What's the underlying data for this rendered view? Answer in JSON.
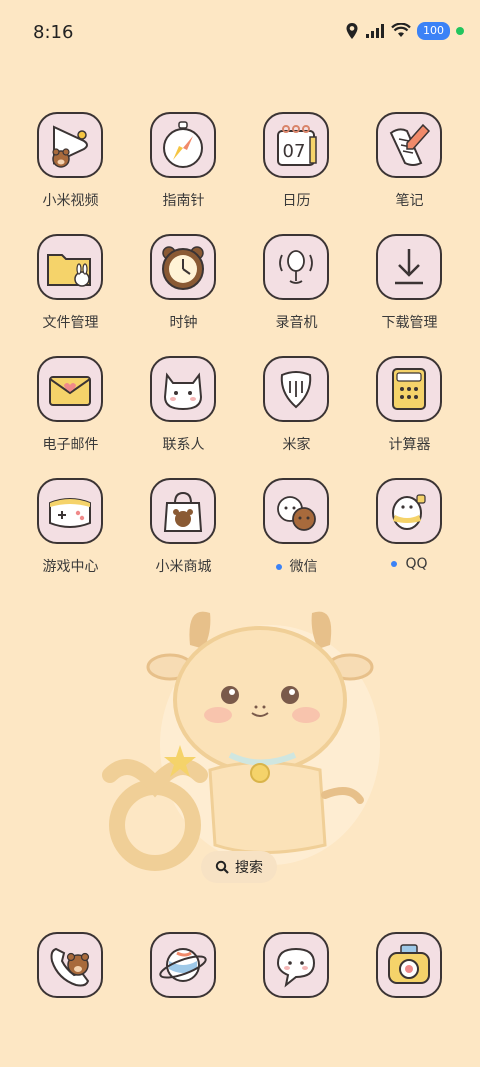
{
  "status": {
    "time": "8:16",
    "battery": "100"
  },
  "apps": [
    {
      "label": "小米视频",
      "badge": false,
      "icon": "video-icon"
    },
    {
      "label": "指南针",
      "badge": false,
      "icon": "compass-icon"
    },
    {
      "label": "日历",
      "badge": false,
      "icon": "calendar-icon",
      "icon_text": "07"
    },
    {
      "label": "笔记",
      "badge": false,
      "icon": "notes-icon"
    },
    {
      "label": "文件管理",
      "badge": false,
      "icon": "folder-icon"
    },
    {
      "label": "时钟",
      "badge": false,
      "icon": "clock-icon"
    },
    {
      "label": "录音机",
      "badge": false,
      "icon": "recorder-icon"
    },
    {
      "label": "下载管理",
      "badge": false,
      "icon": "download-icon"
    },
    {
      "label": "电子邮件",
      "badge": false,
      "icon": "mail-icon"
    },
    {
      "label": "联系人",
      "badge": false,
      "icon": "contacts-icon"
    },
    {
      "label": "米家",
      "badge": false,
      "icon": "mijia-icon"
    },
    {
      "label": "计算器",
      "badge": false,
      "icon": "calculator-icon"
    },
    {
      "label": "游戏中心",
      "badge": false,
      "icon": "gamepad-icon"
    },
    {
      "label": "小米商城",
      "badge": false,
      "icon": "shop-bag-icon"
    },
    {
      "label": "微信",
      "badge": true,
      "icon": "wechat-icon"
    },
    {
      "label": "QQ",
      "badge": true,
      "icon": "qq-icon"
    }
  ],
  "search": {
    "label": "搜索"
  },
  "dock": [
    {
      "icon": "phone-icon"
    },
    {
      "icon": "browser-icon"
    },
    {
      "icon": "messages-icon"
    },
    {
      "icon": "camera-icon"
    }
  ],
  "colors": {
    "background": "#fde7c4",
    "icon_bg": "#f3dfe3",
    "badge": "#3b82f6"
  }
}
